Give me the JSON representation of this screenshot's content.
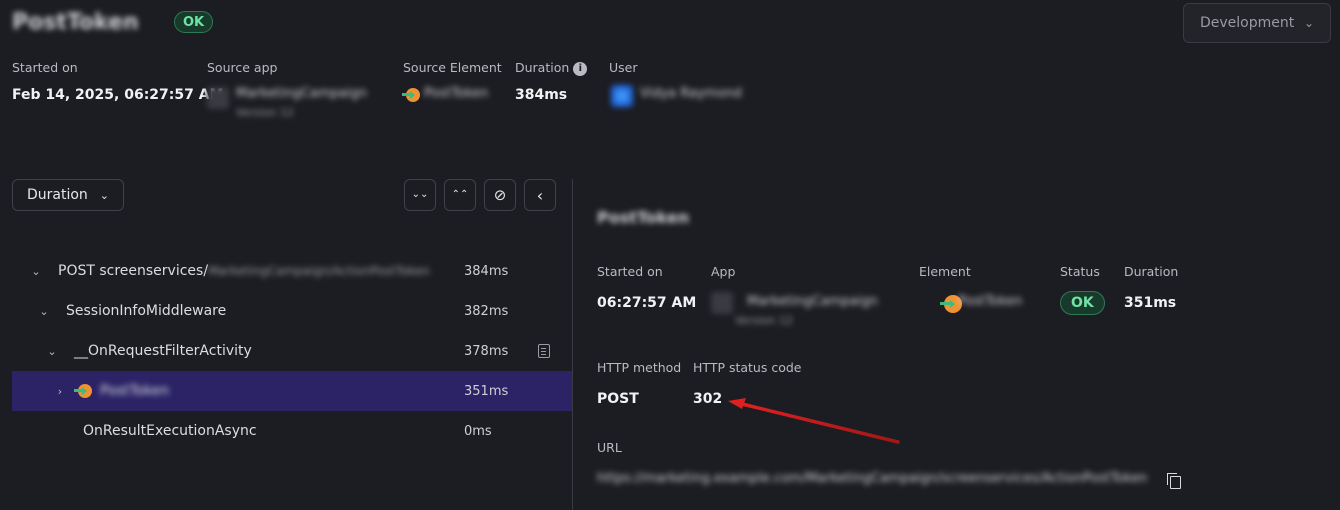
{
  "header": {
    "title": "PostToken",
    "status": "OK",
    "environment": "Development"
  },
  "summary": {
    "started_on_label": "Started on",
    "started_on_value": "Feb 14, 2025, 06:27:57 AM",
    "source_app_label": "Source app",
    "source_app_name": "MarketingCampaign",
    "source_app_sub": "Version 12",
    "source_element_label": "Source Element",
    "source_element_value": "PostToken",
    "duration_label": "Duration",
    "duration_value": "384ms",
    "user_label": "User",
    "user_value": "Vidya Raymond"
  },
  "toolbar": {
    "sort_label": "Duration",
    "expand_all": "⌄⌄",
    "collapse_all": "⌃⌃",
    "hide": "⊘",
    "collapse_panel": "‹"
  },
  "tree": [
    {
      "label": "POST screenservices/",
      "label_hidden": "MarketingCampaign/ActionPostToken",
      "duration": "384ms"
    },
    {
      "label": "SessionInfoMiddleware",
      "duration": "382ms"
    },
    {
      "label": "__OnRequestFilterActivity",
      "duration": "378ms"
    },
    {
      "label": "PostToken",
      "duration": "351ms"
    },
    {
      "label": "OnResultExecutionAsync",
      "duration": "0ms"
    }
  ],
  "detail": {
    "title": "PostToken",
    "started_on_label": "Started on",
    "started_on_value": "06:27:57 AM",
    "app_label": "App",
    "app_name": "MarketingCampaign",
    "app_sub": "Version 12",
    "element_label": "Element",
    "element_value": "PostToken",
    "status_label": "Status",
    "status_value": "OK",
    "duration_label": "Duration",
    "duration_value": "351ms",
    "http_method_label": "HTTP method",
    "http_method_value": "POST",
    "http_status_label": "HTTP status code",
    "http_status_value": "302",
    "url_label": "URL",
    "url_value": "https://marketing.example.com/MarketingCampaign/screenservices/ActionPostToken"
  },
  "colors": {
    "background": "#1c1d22",
    "selected_row": "#2b2366",
    "ok_green": "#6fe3a5",
    "annotation_red": "#d81e1e"
  }
}
